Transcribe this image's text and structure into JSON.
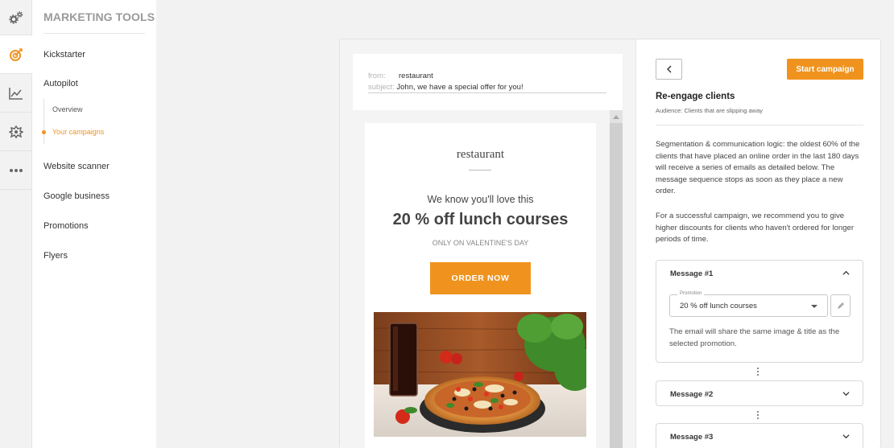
{
  "nav_rail": {
    "icons": [
      "gears-icon",
      "target-icon",
      "chart-icon",
      "puzzle-icon",
      "more-icon"
    ],
    "accent": "#f0931e"
  },
  "sidebar": {
    "title": "MARKETING TOOLS",
    "items": [
      {
        "label": "Kickstarter"
      },
      {
        "label": "Autopilot"
      },
      {
        "label": "Website scanner"
      },
      {
        "label": "Google business"
      },
      {
        "label": "Promotions"
      },
      {
        "label": "Flyers"
      }
    ],
    "subitems": [
      {
        "label": "Overview"
      },
      {
        "label": "Your campaigns"
      }
    ]
  },
  "email_preview": {
    "from_key": "from:",
    "from_value": "restaurant",
    "subject_key": "subject:",
    "subject_value": "John, we have a special offer for you!",
    "brand": "restaurant",
    "tagline": "We know you'll love this",
    "headline": "20 % off lunch courses",
    "subline": "ONLY ON VALENTINE'S DAY",
    "cta": "ORDER NOW"
  },
  "campaign": {
    "back_icon": "chevron-left-icon",
    "start_label": "Start campaign",
    "title": "Re-engage clients",
    "audience": "Audience: Clients that are slipping away",
    "para1": "Segmentation & communication logic: the oldest 60% of the clients that have placed an online order in the last 180 days will receive a series of emails as detailed below. The message sequence stops as soon as they place a new order.",
    "para2": "For a successful campaign, we recommend you to give higher discounts for clients who haven't ordered for longer periods of time.",
    "messages": [
      {
        "title": "Message #1",
        "promotion_label": "Promotion",
        "promotion_value": "20 % off lunch courses",
        "note": "The email will share the same image & title as the selected promotion."
      },
      {
        "title": "Message #2"
      },
      {
        "title": "Message #3"
      }
    ]
  },
  "colors": {
    "accent": "#f0931e",
    "background": "#f2f2f2"
  }
}
